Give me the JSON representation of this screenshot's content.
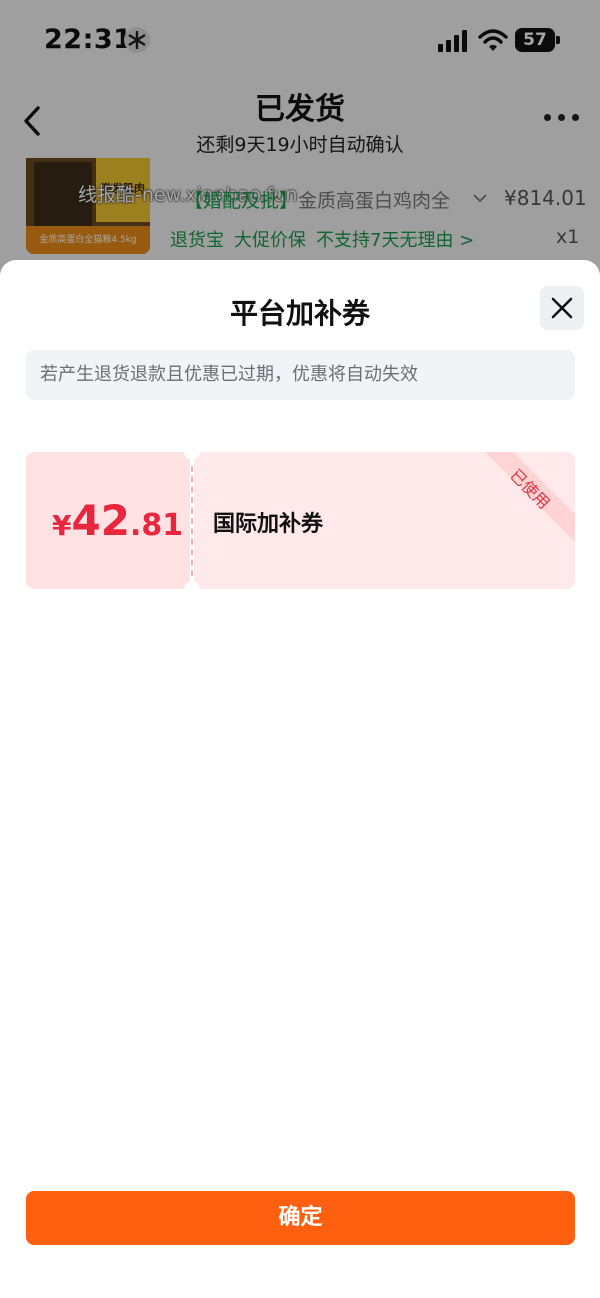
{
  "status_bar": {
    "time": "22:31",
    "battery": "57"
  },
  "header": {
    "back_icon": "chevron-left-icon",
    "title": "已发货",
    "subtitle": "还剩9天19小时自动确认",
    "more_icon": "more-dots-icon"
  },
  "product": {
    "image_badge": "激发肌肉",
    "image_caption": "金质高蛋白全猫粮4.5kg",
    "watermark": "线报酷-new.xianbao.fun",
    "title_tag": "【婚配及批】",
    "title": "金质高蛋白鸡肉全",
    "price": "¥814.01",
    "services": [
      "退货宝",
      "大促价保",
      "不支持7天无理由 >"
    ],
    "quantity": "x1"
  },
  "sheet": {
    "title": "平台加补券",
    "close_icon": "close-icon",
    "notice": "若产生退货退款且优惠已过期，优惠将自动失效",
    "coupon": {
      "currency": "¥",
      "amount_int": "42",
      "amount_dec": ".81",
      "name": "国际加补券",
      "status": "已使用"
    },
    "confirm_label": "确定"
  },
  "colors": {
    "accent": "#ff6010",
    "coupon_red": "#e8263d",
    "service_green": "#1a9b4a"
  }
}
